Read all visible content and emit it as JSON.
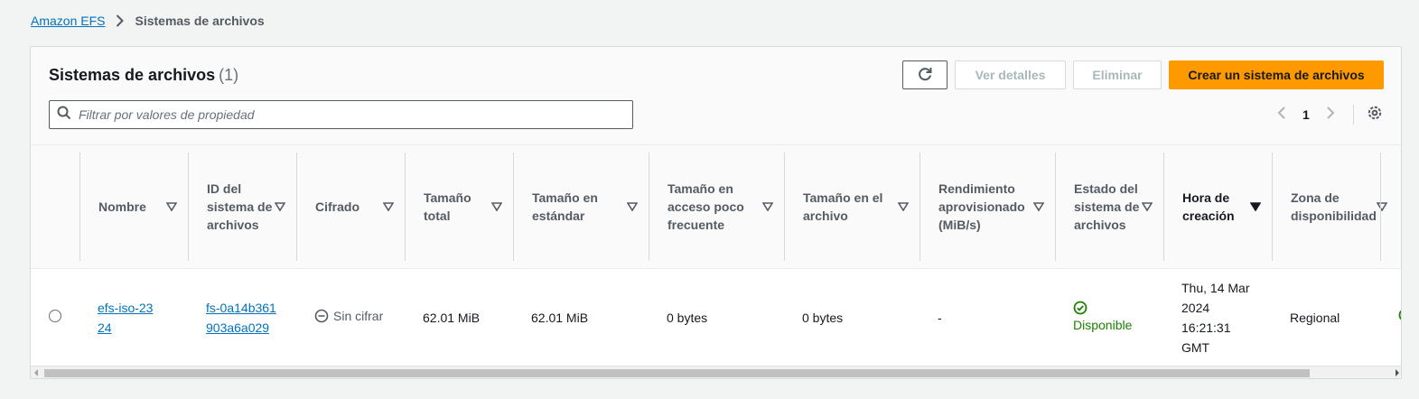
{
  "breadcrumb": {
    "root": "Amazon EFS",
    "current": "Sistemas de archivos"
  },
  "panel": {
    "title": "Sistemas de archivos",
    "count": "(1)"
  },
  "actions": {
    "details": "Ver detalles",
    "delete": "Eliminar",
    "create": "Crear un sistema de archivos"
  },
  "search": {
    "placeholder": "Filtrar por valores de propiedad"
  },
  "pagination": {
    "current_page": "1"
  },
  "columns": [
    "Nombre",
    "ID del sistema de archivos",
    "Cifrado",
    "Tamaño total",
    "Tamaño en estándar",
    "Tamaño en acceso poco frecuente",
    "Tamaño en el archivo",
    "Rendimiento aprovisionado (MiB/s)",
    "Estado del sistema de archivos",
    "Hora de creación",
    "Zona de disponibilidad"
  ],
  "rows": [
    {
      "name": "efs-iso-2324",
      "id": "fs-0a14b361903a6a029",
      "encryption": "Sin cifrar",
      "total_size": "62.01 MiB",
      "standard_size": "62.01 MiB",
      "ia_size": "0 bytes",
      "archive_size": "0 bytes",
      "throughput": "-",
      "status": "Disponible",
      "created": "Thu, 14 Mar 2024 16:21:31 GMT",
      "zone": "Regional"
    }
  ],
  "colors": {
    "primary": "#ff9900",
    "link": "#0073bb",
    "success": "#1d8102"
  },
  "icons": [
    "chevron-right-icon",
    "refresh-icon",
    "search-icon",
    "chevron-left-icon",
    "gear-icon",
    "sort-icon",
    "minus-circle-icon",
    "check-circle-icon"
  ]
}
